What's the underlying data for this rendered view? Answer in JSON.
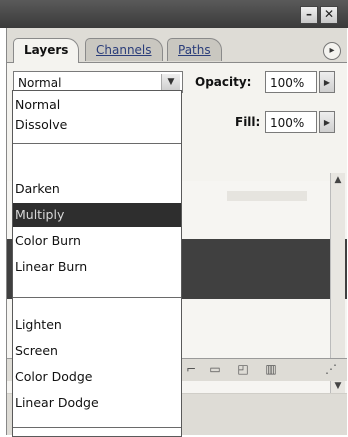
{
  "window": {
    "minimize_glyph": "–",
    "close_glyph": "✕"
  },
  "tabs": [
    {
      "label": "Layers",
      "active": true
    },
    {
      "label": "Channels",
      "active": false
    },
    {
      "label": "Paths",
      "active": false
    }
  ],
  "panel_menu_glyph": "▸",
  "blend_mode": {
    "selected": "Normal",
    "arrow_glyph": "▼"
  },
  "opacity": {
    "label": "Opacity:",
    "value": "100%"
  },
  "fill": {
    "label": "Fill:",
    "value": "100%"
  },
  "blend_menu": {
    "groups": [
      [
        "Normal",
        "Dissolve"
      ],
      [
        "Darken",
        "Multiply",
        "Color Burn",
        "Linear Burn"
      ],
      [
        "Lighten",
        "Screen",
        "Color Dodge",
        "Linear Dodge"
      ]
    ],
    "highlighted": "Multiply"
  },
  "scrollbar": {
    "up_glyph": "▲",
    "down_glyph": "▼"
  }
}
